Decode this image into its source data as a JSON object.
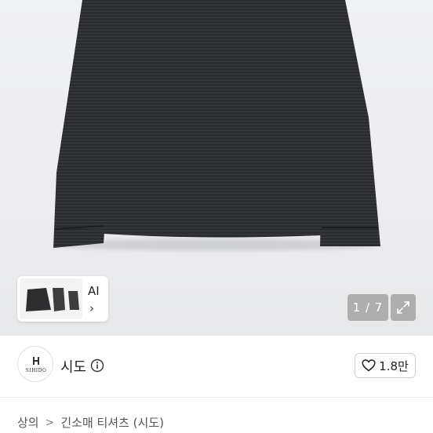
{
  "hero": {
    "product_image": "black-striped-long-sleeve-tshirt",
    "counter": "1 / 7",
    "thumb_ai_label": "AI",
    "thumb_chevron": "›"
  },
  "seller": {
    "logo_text": "SIHIDO",
    "name": "시도",
    "like_count": "1.8만"
  },
  "breadcrumb": {
    "category": "상의",
    "separator": ">",
    "subcategory": "긴소매 티셔츠 (시도)"
  },
  "colors": {
    "garment": "#2b2c2e",
    "background": "#eeeff1",
    "overlay": "#505050"
  }
}
